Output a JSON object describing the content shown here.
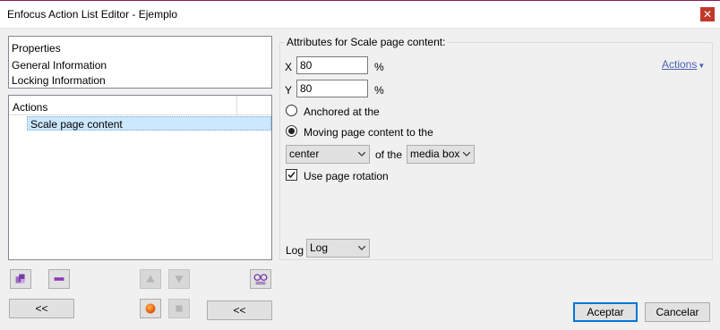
{
  "window": {
    "title": "Enfocus Action List Editor - Ejemplo",
    "close_icon": "close-icon",
    "accent_color": "#8a1a56"
  },
  "properties_panel": {
    "header": "Properties",
    "items": [
      "General Information",
      "Locking Information"
    ]
  },
  "actions_panel": {
    "header": "Actions",
    "items": [
      {
        "label": "Scale page content",
        "selected": true
      }
    ]
  },
  "toolbar": {
    "add_icon": "add-action-icon",
    "remove_icon": "remove-action-icon",
    "up_icon": "move-up-icon",
    "down_icon": "move-down-icon",
    "preview_icon": "glasses-icon",
    "record_icon": "record-icon",
    "stop_icon": "stop-icon",
    "collapse_left_label": "<<",
    "collapse_right_label": "<<"
  },
  "attributes": {
    "group_title": "Attributes for Scale page content:",
    "actions_link": "Actions",
    "x_label": "X",
    "x_value": "80",
    "x_unit": "%",
    "y_label": "Y",
    "y_value": "80",
    "y_unit": "%",
    "anchored_label": "Anchored at the",
    "moving_label": "Moving page content to the",
    "position_select": "center",
    "of_the_label": "of the",
    "box_select": "media box",
    "use_rotation_label": "Use page rotation",
    "use_rotation_checked": true,
    "log_label": "Log",
    "log_select": "Log"
  },
  "dialog": {
    "ok_label": "Aceptar",
    "cancel_label": "Cancelar"
  }
}
